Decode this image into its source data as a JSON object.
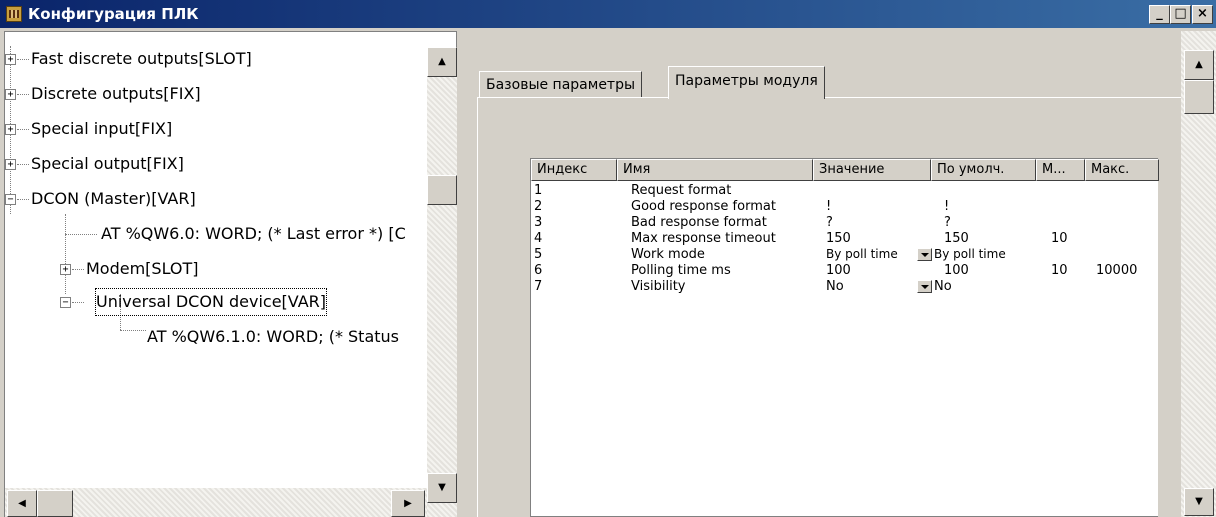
{
  "window": {
    "title": "Конфигурация ПЛК",
    "minimize": "_",
    "maximize": "□",
    "close": "×"
  },
  "tree": {
    "items": [
      {
        "label": "Fast discrete outputs[SLOT]",
        "expander": "+"
      },
      {
        "label": "Discrete outputs[FIX]",
        "expander": "+"
      },
      {
        "label": "Special input[FIX]",
        "expander": "+"
      },
      {
        "label": "Special output[FIX]",
        "expander": "+"
      },
      {
        "label": "DCON (Master)[VAR]",
        "expander": "−"
      },
      {
        "label": "AT %QW6.0: WORD; (* Last error *) [C"
      },
      {
        "label": "Modem[SLOT]",
        "expander": "+"
      },
      {
        "label": "Universal DCON device[VAR]",
        "expander": "−"
      },
      {
        "label": "AT %QW6.1.0: WORD; (* Status"
      }
    ]
  },
  "tabs": [
    {
      "label": "Базовые параметры"
    },
    {
      "label": "Параметры модуля"
    }
  ],
  "table": {
    "columns": [
      "Индекс",
      "Имя",
      "Значение",
      "По умолч.",
      "М...",
      "Макс."
    ],
    "rows": [
      {
        "index": "1",
        "name": "Request format",
        "value": "",
        "default": "",
        "min": "",
        "max": ""
      },
      {
        "index": "2",
        "name": "Good response format",
        "value": "!",
        "default": "!",
        "min": "",
        "max": ""
      },
      {
        "index": "3",
        "name": "Bad response format",
        "value": "?",
        "default": "?",
        "min": "",
        "max": ""
      },
      {
        "index": "4",
        "name": "Max response timeout",
        "value": "150",
        "default": "150",
        "min": "10",
        "max": ""
      },
      {
        "index": "5",
        "name": "Work mode",
        "value": "By poll time",
        "default": "By poll time",
        "min": "",
        "max": ""
      },
      {
        "index": "6",
        "name": "Polling time ms",
        "value": "100",
        "default": "100",
        "min": "10",
        "max": "10000"
      },
      {
        "index": "7",
        "name": "Visibility",
        "value": "No",
        "default": "No",
        "min": "",
        "max": ""
      }
    ]
  },
  "icons": {
    "app": "plc-config-icon",
    "scroll_up": "▲",
    "scroll_down": "▼",
    "scroll_left": "◀",
    "scroll_right": "▶"
  }
}
